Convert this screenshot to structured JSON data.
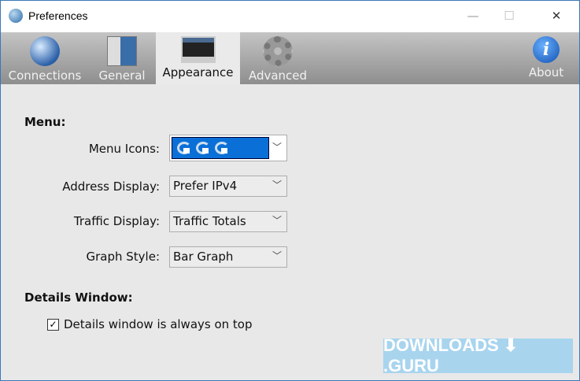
{
  "window": {
    "title": "Preferences",
    "minimize": "—",
    "maximize": "☐",
    "close": "✕"
  },
  "tabs": [
    {
      "label": "Connections"
    },
    {
      "label": "General"
    },
    {
      "label": "Appearance",
      "active": true
    },
    {
      "label": "Advanced"
    },
    {
      "label": "About"
    }
  ],
  "menu": {
    "heading": "Menu:",
    "menu_icons_label": "Menu Icons:",
    "address_label": "Address Display:",
    "address_value": "Prefer IPv4",
    "traffic_label": "Traffic Display:",
    "traffic_value": "Traffic Totals",
    "graph_label": "Graph Style:",
    "graph_value": "Bar Graph"
  },
  "details": {
    "heading": "Details Window:",
    "checkbox_label": "Details window is always on top",
    "checked": true,
    "check": "✓"
  },
  "watermark": "DOWNLOADS ⬇ .GURU"
}
